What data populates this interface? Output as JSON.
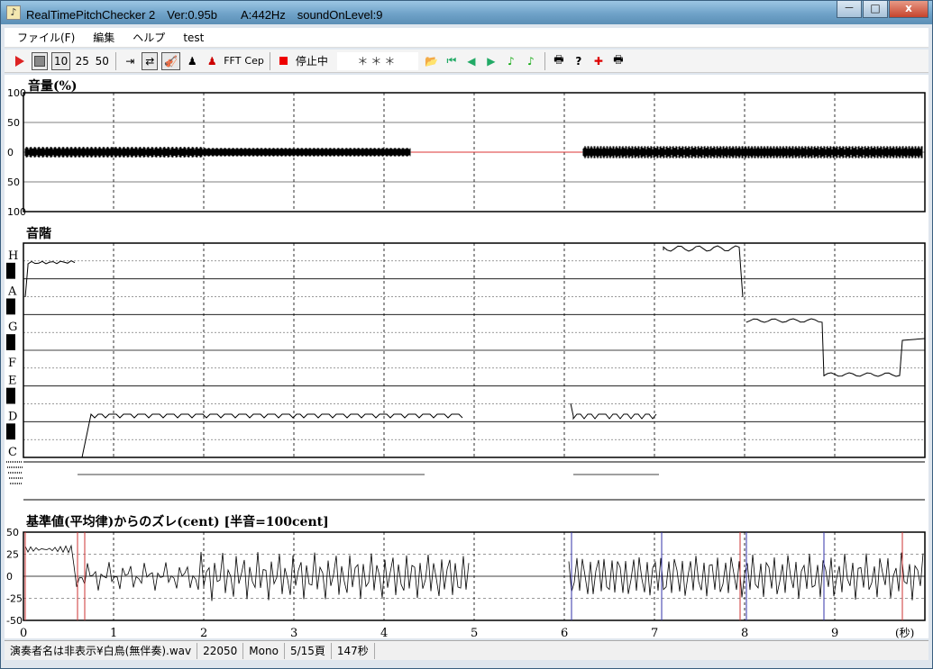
{
  "window": {
    "title": "RealTimePitchChecker 2　Ver:0.95b　　A:442Hz　soundOnLevel:9",
    "app_icon": "app-icon",
    "minimize": "－",
    "maximize": "□",
    "close": "x"
  },
  "menu": [
    "ファイル(F)",
    "編集",
    "ヘルプ",
    "test"
  ],
  "toolbar": {
    "labels": [
      "10",
      "25",
      "50",
      "FFT",
      "Cep"
    ],
    "status": "停止中",
    "field": "＊＊＊"
  },
  "volume_panel": {
    "title": "音量(%)",
    "y_ticks": [
      "100",
      "50",
      "0",
      "50",
      "100"
    ]
  },
  "scale_panel": {
    "title": "音階",
    "notes": [
      "H",
      "A",
      "G",
      "F",
      "E",
      "D",
      "C"
    ]
  },
  "deviation_panel": {
    "title": "基準値(平均律)からのズレ(cent) [半音=100cent]",
    "y_ticks": [
      "50",
      "25",
      "0",
      "-25",
      "-50"
    ],
    "x_ticks": [
      "0",
      "1",
      "2",
      "3",
      "4",
      "5",
      "6",
      "7",
      "8",
      "9"
    ],
    "x_unit": "(秒)"
  },
  "statusbar": [
    "演奏者名は非表示¥白鳥(無伴奏).wav",
    "22050",
    "Mono",
    "5/15頁",
    "147秒"
  ]
}
